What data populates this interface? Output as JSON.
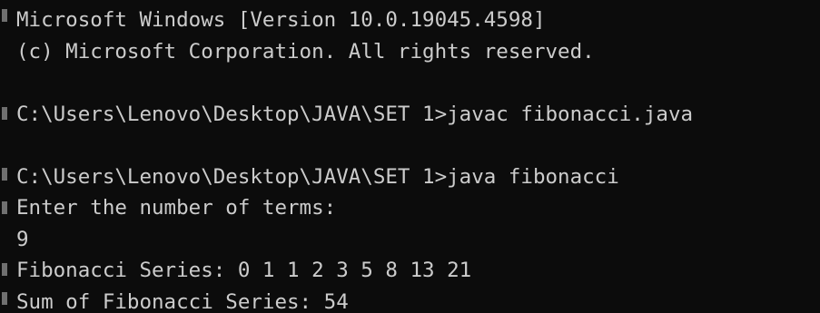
{
  "console": {
    "lines": [
      "Microsoft Windows [Version 10.0.19045.4598]",
      "(c) Microsoft Corporation. All rights reserved.",
      "",
      "C:\\Users\\Lenovo\\Desktop\\JAVA\\SET 1>javac fibonacci.java",
      "",
      "C:\\Users\\Lenovo\\Desktop\\JAVA\\SET 1>java fibonacci",
      "Enter the number of terms:",
      "9",
      "Fibonacci Series: 0 1 1 2 3 5 8 13 21",
      "Sum of Fibonacci Series: 54"
    ]
  },
  "colors": {
    "background": "#0c0c0c",
    "foreground": "#cccccc"
  }
}
